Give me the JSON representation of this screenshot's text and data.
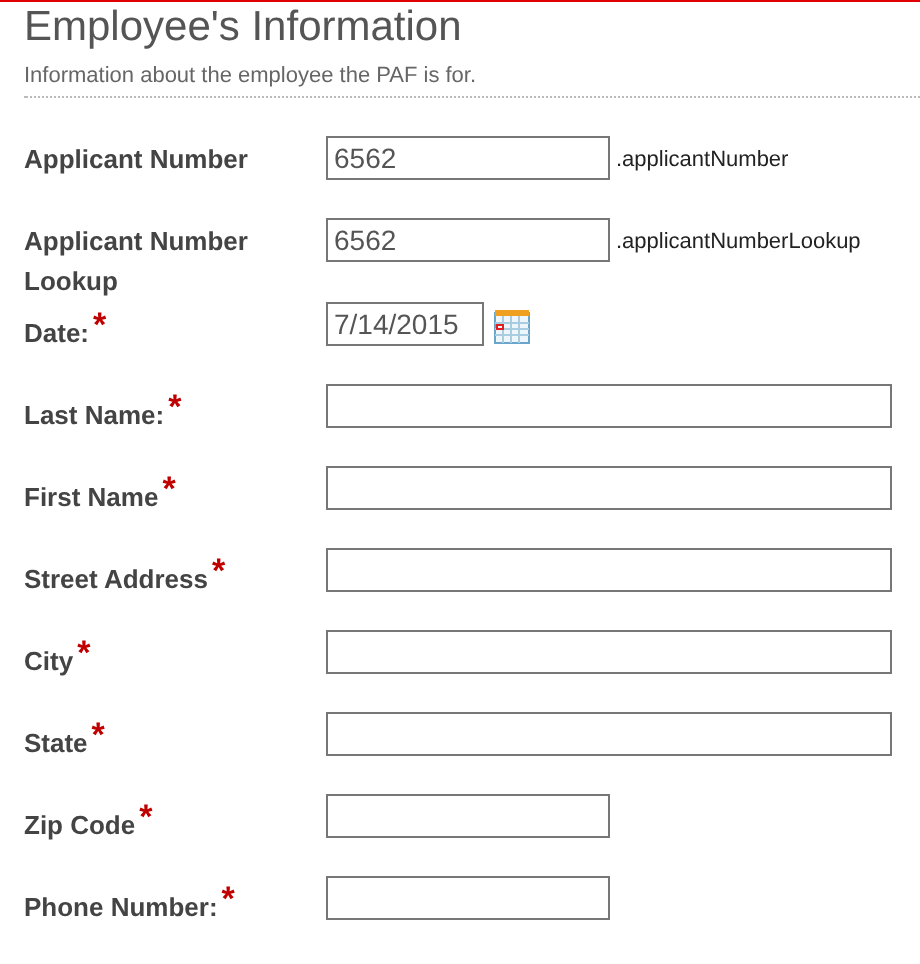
{
  "section": {
    "title": "Employee's Information",
    "description": "Information about the employee the PAF is for."
  },
  "fields": [
    {
      "label": "Applicant Number",
      "kind": "short",
      "value": "6562",
      "suffix": ".applicantNumber"
    },
    {
      "label": "Applicant Number Lookup",
      "kind": "short",
      "value": "6562",
      "suffix": ".applicantNumberLookup"
    },
    {
      "label": "Date:",
      "kind": "date",
      "value": "7/14/2015",
      "required_mark": "*"
    },
    {
      "label": "Last Name:",
      "kind": "long",
      "required_mark": "*"
    },
    {
      "label": "First Name",
      "kind": "long",
      "required_mark": "*"
    },
    {
      "label": "Street Address",
      "kind": "long",
      "required_mark": "*"
    },
    {
      "label": "City",
      "kind": "long",
      "required_mark": "*"
    },
    {
      "label": "State",
      "kind": "long",
      "required_mark": "*"
    },
    {
      "label": "Zip Code",
      "kind": "short",
      "required_mark": "*"
    },
    {
      "label": "Phone Number:",
      "kind": "short",
      "required_mark": "*"
    }
  ]
}
